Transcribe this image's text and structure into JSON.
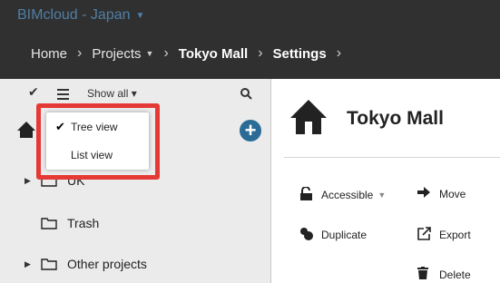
{
  "header": {
    "app_title": "BIMcloud - Japan",
    "breadcrumbs": [
      {
        "label": "Home"
      },
      {
        "label": "Projects"
      },
      {
        "label": "Tokyo Mall"
      },
      {
        "label": "Settings"
      }
    ]
  },
  "sidebar": {
    "show_all_label": "Show all",
    "items": [
      {
        "label": "UK",
        "icon": "folder-icon"
      },
      {
        "label": "Trash",
        "icon": "folder-icon"
      },
      {
        "label": "Other projects",
        "icon": "folder-icon"
      }
    ]
  },
  "view_menu": {
    "items": [
      {
        "label": "Tree view",
        "checked": true
      },
      {
        "label": "List view",
        "checked": false
      }
    ]
  },
  "main": {
    "project_title": "Tokyo Mall",
    "actions": {
      "accessible": "Accessible",
      "move": "Move",
      "duplicate": "Duplicate",
      "export": "Export",
      "delete": "Delete"
    }
  },
  "colors": {
    "header_bg": "#303030",
    "app_title": "#4f7fa6",
    "sidebar_bg": "#ebebeb",
    "add_button": "#2b6c96",
    "highlight": "#e53935"
  }
}
